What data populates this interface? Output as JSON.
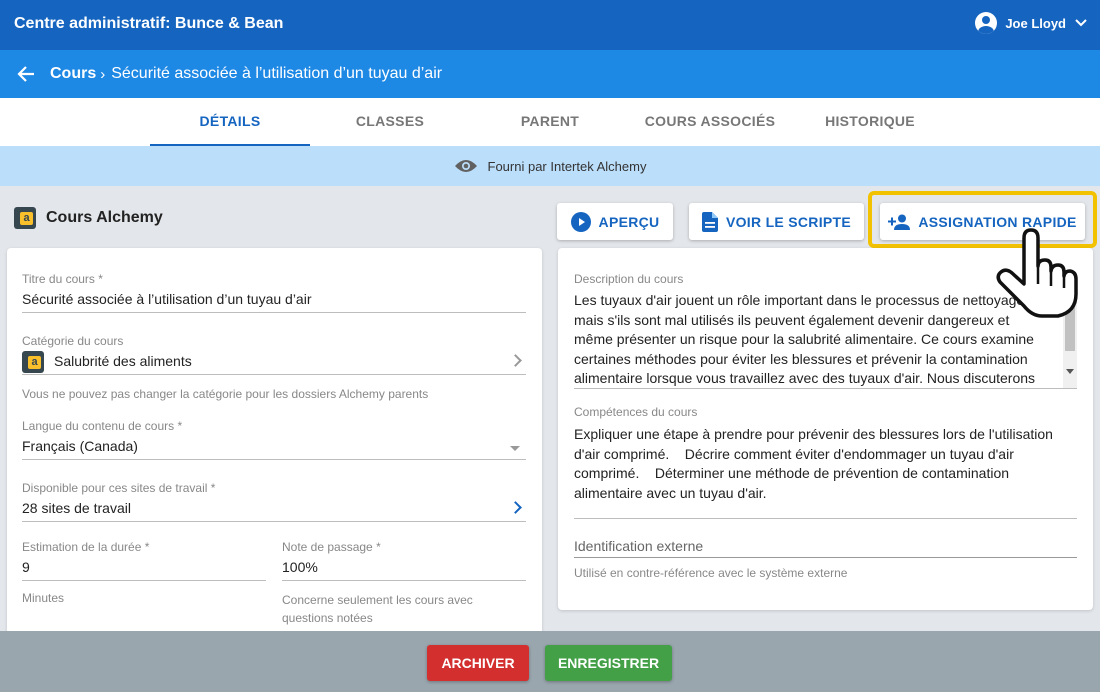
{
  "header": {
    "title": "Centre administratif: Bunce & Bean",
    "user_name": "Joe Lloyd"
  },
  "breadcrumb": {
    "root": "Cours",
    "separator": "›",
    "current": "Sécurité associée à l’utilisation d’un tuyau d’air"
  },
  "tabs": [
    {
      "label": "DÉTAILS",
      "active": true
    },
    {
      "label": "CLASSES"
    },
    {
      "label": "PARENT"
    },
    {
      "label": "COURS ASSOCIÉS"
    },
    {
      "label": "HISTORIQUE"
    }
  ],
  "provider_text": "Fourni par Intertek Alchemy",
  "section_title": "Cours Alchemy",
  "actions": {
    "preview": "APERÇU",
    "script": "VOIR LE SCRIPTE",
    "quick_assign": "ASSIGNATION RAPIDE"
  },
  "form": {
    "title_label": "Titre du cours *",
    "title_value": "Sécurité associée à l’utilisation d’un tuyau d’air",
    "category_label": "Catégorie du cours",
    "category_value": "Salubrité des aliments",
    "category_hint": "Vous ne pouvez pas changer la catégorie pour les dossiers Alchemy parents",
    "language_label": "Langue du contenu de cours *",
    "language_value": "Français (Canada)",
    "sites_label": "Disponible pour ces sites de travail *",
    "sites_value": "28 sites de travail",
    "duration_label": "Estimation de la durée *",
    "duration_value": "9",
    "duration_hint": "Minutes",
    "passing_label": "Note de passage *",
    "passing_value": "100%",
    "passing_hint": "Concerne seulement les cours avec questions notées"
  },
  "details": {
    "description_label": "Description du cours",
    "description_text": "Les tuyaux d'air jouent un rôle important dans le processus de nettoyage, mais s'ils sont mal utilisés ils peuvent également devenir dangereux et même présenter un risque pour la salubrité alimentaire. Ce cours examine certaines méthodes pour éviter les blessures et prévenir la contamination alimentaire lorsque vous travaillez avec des tuyaux d'air. Nous discuterons",
    "skills_label": "Compétences du cours",
    "skills_text": "Expliquer une étape à prendre pour prévenir des blessures lors de l'utilisation d'air comprimé.    Décrire comment éviter d'endommager un tuyau d'air comprimé.    Déterminer une méthode de prévention de contamination alimentaire avec un tuyau d'air.",
    "external_id_label": "Identification externe",
    "external_id_hint": "Utilisé en contre-référence avec le système externe"
  },
  "footer": {
    "archive": "ARCHIVER",
    "save": "ENREGISTRER"
  },
  "colors": {
    "primary": "#1565c0",
    "secondary": "#1e88e5",
    "archive": "#d32f2f",
    "save": "#43a047",
    "highlight": "#f2c200"
  }
}
